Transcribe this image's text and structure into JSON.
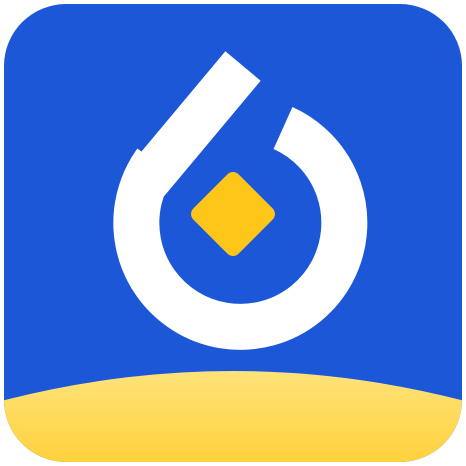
{
  "app_icon": {
    "icon": "droplet-with-diamond-logo-icon",
    "colors": {
      "background": "#1c57d8",
      "background_edge": "#164bc6",
      "mark": "#ffffff",
      "diamond": "#ffc61a",
      "ground": "#ffcf33",
      "ground_highlight": "#ffe27a"
    }
  }
}
